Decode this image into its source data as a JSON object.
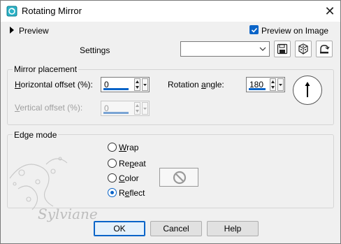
{
  "window": {
    "title": "Rotating Mirror",
    "close_glyph": "✕"
  },
  "preview": {
    "toggle_label": "Preview",
    "checkbox_label": "Preview on Image",
    "checked": true
  },
  "settings": {
    "label": "Settings",
    "combo_value": ""
  },
  "toolbar": {
    "icons": [
      "save-icon",
      "dice-icon",
      "reset-icon"
    ]
  },
  "mirror_placement": {
    "title": "Mirror placement",
    "horizontal_offset": {
      "label_pre": "",
      "label_u": "H",
      "label_post": "orizontal offset (%):",
      "value": "0"
    },
    "vertical_offset": {
      "label_pre": "",
      "label_u": "V",
      "label_post": "ertical offset (%):",
      "value": "0",
      "disabled": true
    },
    "rotation_angle": {
      "label_pre": "Rotation ",
      "label_u": "a",
      "label_post": "ngle:",
      "value": "180"
    }
  },
  "edge_mode": {
    "title": "Edge mode",
    "options": [
      {
        "pre": "",
        "u": "W",
        "post": "rap",
        "selected": false
      },
      {
        "pre": "Re",
        "u": "p",
        "post": "eat",
        "selected": false
      },
      {
        "pre": "",
        "u": "C",
        "post": "olor",
        "selected": false
      },
      {
        "pre": "R",
        "u": "e",
        "post": "flect",
        "selected": true
      }
    ]
  },
  "buttons": {
    "ok": "OK",
    "cancel": "Cancel",
    "help": "Help"
  },
  "watermark": {
    "text": "Sylviane"
  },
  "colors": {
    "accent": "#0a64c8",
    "titlebar": "#ffffff",
    "dialog_bg": "#f0f0f0"
  }
}
